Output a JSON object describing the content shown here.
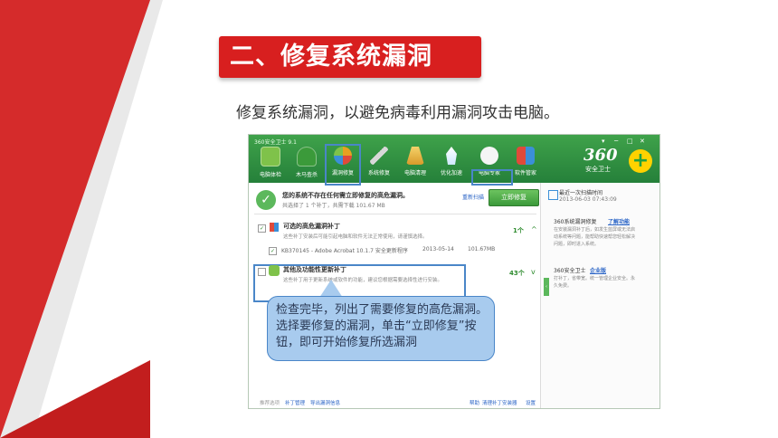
{
  "slide": {
    "title": "二、修复系统漏洞",
    "subtitle": "修复系统漏洞，以避免病毒利用漏洞攻击电脑。",
    "callout": "检查完毕，列出了需要修复的高危漏洞。选择要修复的漏洞，单击“立即修复”按钮，即可开始修复所选漏洞"
  },
  "app": {
    "title": "360安全卫士 9.1",
    "logo": "360",
    "logo_sub": "安全卫士",
    "logo_plus": "+",
    "toolbar": [
      "电脑体检",
      "木马查杀",
      "漏洞修复",
      "系统修复",
      "电脑清理",
      "优化加速",
      "电脑专家",
      "软件管家"
    ],
    "toolbar_colors": [
      "#7fc24a",
      "#3b9a3a",
      "#e8a020",
      "#d0d0d0",
      "#e6b84a",
      "#f2f2f2",
      "#f5f5f5",
      "#e04a3a"
    ],
    "status": {
      "message": "您的系统不存在任何需立即修复的高危漏洞。",
      "detail": "共选择了 1 个补丁，共需下载 101.67 MB",
      "rescan": "重新扫描",
      "fix_button": "立即修复"
    },
    "group1": {
      "title": "可选的高危漏洞补丁",
      "desc": "这些补丁安装后可能引起电脑和软件无法正常使用，请谨慎选择。",
      "count": "1个",
      "patch": {
        "id": "KB370145 - Adobe Acrobat 10.1.7 安全更新程序",
        "date": "2013-05-14",
        "size": "101.67MB"
      }
    },
    "group2": {
      "title": "其他及功能性更新补丁",
      "desc": "这些补丁用于更新系统或软件的功能，建议您根据需要选择性进行安装。",
      "count": "43个"
    },
    "footer": {
      "left_label": "推荐选项",
      "links": [
        "补丁管理",
        "导出漏洞信息"
      ],
      "right_links": [
        "帮助",
        "清理补丁安装器",
        "设置"
      ]
    },
    "sidebar": {
      "last_scan_label": "最近一次扫描时间",
      "last_scan_time": "2013-06-03 07:43:09",
      "block1_title": "360系统漏洞修复",
      "block1_link": "了解功能",
      "block1_text": [
        "在安装漏洞补丁后，如发生蓝屏或无法启",
        "动系统等问题，能帮助快速帮您轻松解决",
        "问题，即时进入系统。"
      ],
      "block2_title": "360安全卫士",
      "block2_link": "企业版",
      "block2_text": [
        "打补丁，省带宽。统一管理企业安全。永",
        "久免费。"
      ]
    },
    "window_controls": [
      "▾",
      "─",
      "□",
      "✕"
    ]
  }
}
